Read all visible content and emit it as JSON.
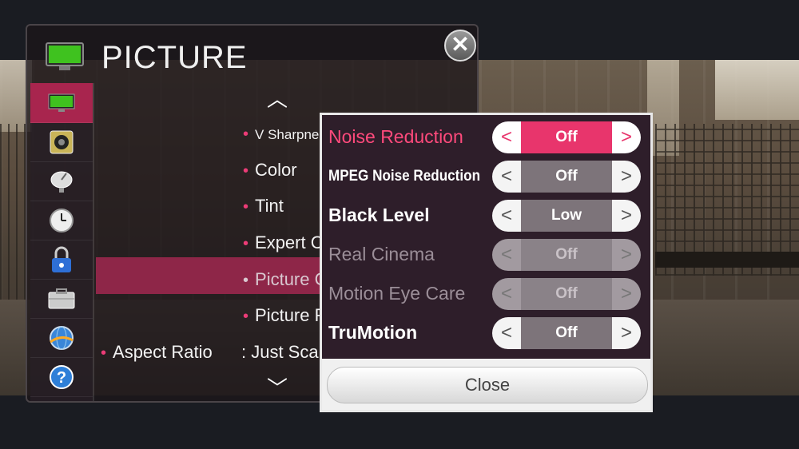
{
  "header": {
    "title": "PICTURE"
  },
  "sidebar": {
    "items": [
      {
        "icon": "picture-icon",
        "active": true
      },
      {
        "icon": "speaker-icon"
      },
      {
        "icon": "satellite-dish-icon"
      },
      {
        "icon": "clock-icon"
      },
      {
        "icon": "lock-icon"
      },
      {
        "icon": "toolbox-icon"
      },
      {
        "icon": "globe-icon"
      },
      {
        "icon": "help-icon"
      }
    ]
  },
  "menu": {
    "items": [
      {
        "label": "V Sharpness"
      },
      {
        "label": "Color"
      },
      {
        "label": "Tint"
      },
      {
        "label": "Expert C"
      },
      {
        "label": "Picture C"
      },
      {
        "label": "Picture R"
      }
    ],
    "aspect_ratio": {
      "label": "Aspect Ratio",
      "value": ": Just Sca"
    }
  },
  "popup": {
    "rows": [
      {
        "label": "Noise Reduction",
        "value": "Off",
        "state": "active"
      },
      {
        "label": "MPEG Noise Reduction",
        "value": "Off",
        "state": "normal"
      },
      {
        "label": "Black Level",
        "value": "Low",
        "state": "normal"
      },
      {
        "label": "Real Cinema",
        "value": "Off",
        "state": "dim"
      },
      {
        "label": "Motion Eye Care",
        "value": "Off",
        "state": "dim"
      },
      {
        "label": "TruMotion",
        "value": "Off",
        "state": "normal"
      }
    ],
    "close_label": "Close"
  },
  "colors": {
    "accent": "#e8356c",
    "highlight": "#8e2648"
  }
}
